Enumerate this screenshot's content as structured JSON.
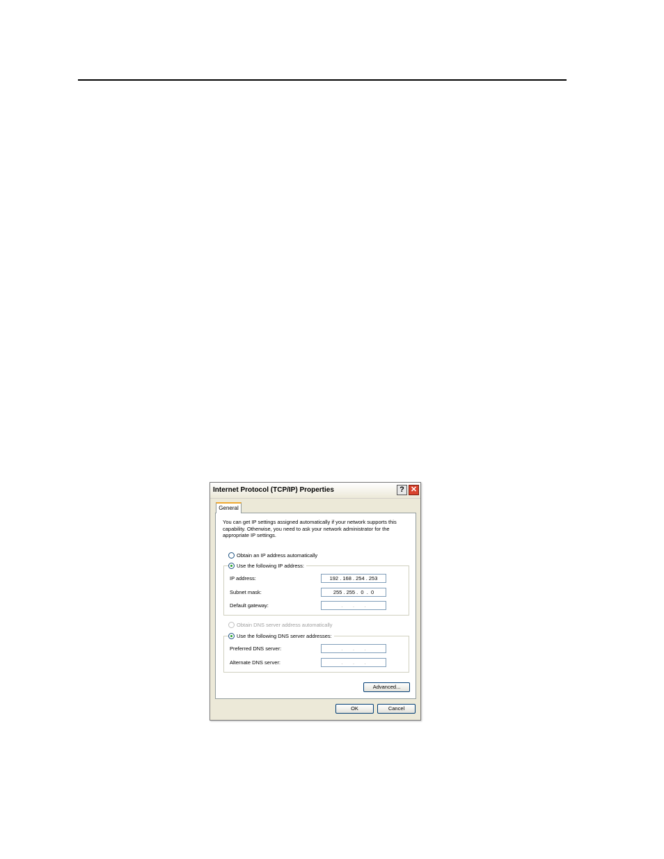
{
  "dialog": {
    "title": "Internet Protocol (TCP/IP) Properties",
    "help_glyph": "?",
    "close_glyph": "✕",
    "tab_label": "General",
    "intro_text": "You can get IP settings assigned automatically if your network supports this capability. Otherwise, you need to ask your network administrator for the appropriate IP settings.",
    "ip_section": {
      "auto_radio_label": "Obtain an IP address automatically",
      "manual_radio_label": "Use the following IP address:",
      "selected": "manual",
      "fields": [
        {
          "label": "IP address:",
          "value": "192 . 168 . 254 . 253"
        },
        {
          "label": "Subnet mask:",
          "value": "255 . 255 .  0  .  0"
        },
        {
          "label": "Default gateway:",
          "value": "     .       .       .     "
        }
      ]
    },
    "dns_section": {
      "auto_radio_label": "Obtain DNS server address automatically",
      "manual_radio_label": "Use the following DNS server addresses:",
      "selected": "manual",
      "auto_disabled": true,
      "fields": [
        {
          "label": "Preferred DNS server:",
          "value": "     .       .       .     "
        },
        {
          "label": "Alternate DNS server:",
          "value": "     .       .       .     "
        }
      ]
    },
    "advanced_label": "Advanced...",
    "ok_label": "OK",
    "cancel_label": "Cancel"
  }
}
